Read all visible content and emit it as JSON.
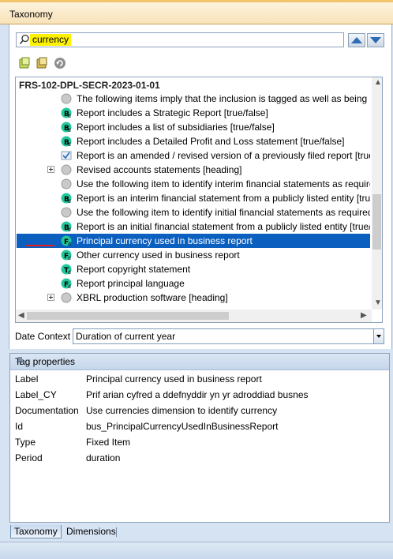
{
  "window": {
    "title": "Taxonomy"
  },
  "search": {
    "value": "currency"
  },
  "tree": {
    "title": "FRS-102-DPL-SECR-2023-01-01",
    "rows": [
      {
        "label": "The following items imply that the inclusion is tagged as well as being prese",
        "icon": "grey-circle-icon",
        "expander": false
      },
      {
        "label": "Report includes a Strategic Report [true/false]",
        "icon": "boolean-item-icon",
        "expander": false
      },
      {
        "label": "Report includes a list of subsidiaries [true/false]",
        "icon": "boolean-item-icon",
        "expander": false
      },
      {
        "label": "Report includes a Detailed Profit and Loss statement [true/false]",
        "icon": "boolean-item-icon",
        "expander": false
      },
      {
        "label": "Report is an amended / revised version of a previously filed report [true/fals",
        "icon": "checklist-icon",
        "expander": false
      },
      {
        "label": "Revised accounts statements [heading]",
        "icon": "grey-circle-icon",
        "expander": true
      },
      {
        "label": "Use the following item to identify interim financial statements as required by",
        "icon": "grey-circle-icon",
        "expander": false
      },
      {
        "label": "Report is an interim financial statement from a publicly listed entity [true/fal",
        "icon": "boolean-item-icon",
        "expander": false
      },
      {
        "label": "Use the following item to identify initial financial statements as required by S",
        "icon": "grey-circle-icon",
        "expander": false
      },
      {
        "label": "Report is an initial financial statement from a publicly listed entity [true/false",
        "icon": "boolean-item-icon",
        "expander": false
      },
      {
        "label": "Principal currency used in business report",
        "icon": "fixed-item-icon",
        "expander": false,
        "selected": true
      },
      {
        "label": "Other currency used in business report",
        "icon": "fixed-item-icon",
        "expander": false
      },
      {
        "label": "Report copyright statement",
        "icon": "text-item-icon",
        "expander": false
      },
      {
        "label": "Report principal language",
        "icon": "fixed-item-icon",
        "expander": false
      },
      {
        "label": "XBRL production software [heading]",
        "icon": "grey-circle-icon",
        "expander": true
      }
    ]
  },
  "date_context": {
    "label": "Date Context",
    "value": "Duration of current year"
  },
  "tag_properties": {
    "header": "Tag properties",
    "rows": [
      {
        "key": "Label",
        "value": "Principal currency used in business report"
      },
      {
        "key": "Label_CY",
        "value": "Prif arian cyfred a ddefnyddir yn yr adroddiad busnes"
      },
      {
        "key": "Documentation",
        "value": "Use currencies dimension to identify currency"
      },
      {
        "key": "Id",
        "value": "bus_PrincipalCurrencyUsedInBusinessReport"
      },
      {
        "key": "Type",
        "value": "Fixed Item"
      },
      {
        "key": "Period",
        "value": "duration"
      }
    ]
  },
  "bottom_tabs": {
    "taxonomy": "Taxonomy",
    "dimensions": "Dimensions"
  },
  "colors": {
    "selection": "#0a5fbf",
    "search_highlight": "#fff200",
    "item_icon": "#21c79b"
  }
}
